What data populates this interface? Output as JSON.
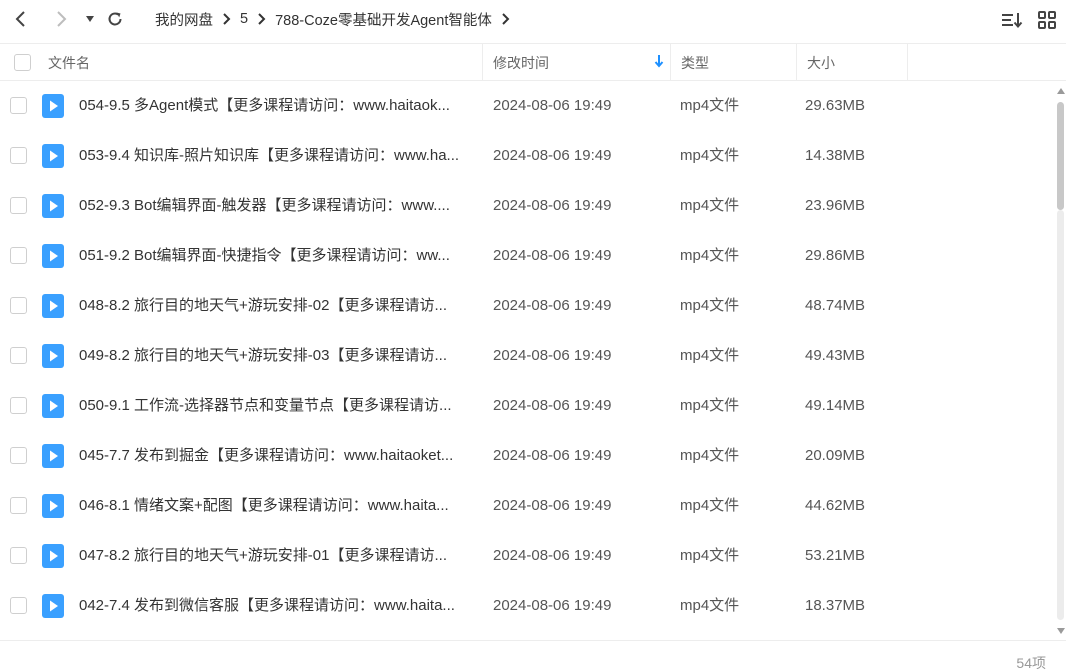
{
  "toolbar": {
    "back_icon": "chevron-left-icon",
    "forward_icon": "chevron-right-icon",
    "history_icon": "caret-down-icon",
    "refresh_icon": "refresh-icon",
    "sort_icon": "sort-list-icon",
    "view_icon": "grid-view-icon"
  },
  "breadcrumb": [
    "我的网盘",
    "5",
    "788-Coze零基础开发Agent智能体"
  ],
  "columns": {
    "name": "文件名",
    "modified": "修改时间",
    "type": "类型",
    "size": "大小"
  },
  "files": [
    {
      "name": "054-9.5 多Agent模式【更多课程请访问：www.haitaok...",
      "modified": "2024-08-06 19:49",
      "type": "mp4文件",
      "size": "29.63MB"
    },
    {
      "name": "053-9.4 知识库-照片知识库【更多课程请访问：www.ha...",
      "modified": "2024-08-06 19:49",
      "type": "mp4文件",
      "size": "14.38MB"
    },
    {
      "name": "052-9.3 Bot编辑界面-触发器【更多课程请访问：www....",
      "modified": "2024-08-06 19:49",
      "type": "mp4文件",
      "size": "23.96MB"
    },
    {
      "name": "051-9.2 Bot编辑界面-快捷指令【更多课程请访问：ww...",
      "modified": "2024-08-06 19:49",
      "type": "mp4文件",
      "size": "29.86MB"
    },
    {
      "name": "048-8.2 旅行目的地天气+游玩安排-02【更多课程请访...",
      "modified": "2024-08-06 19:49",
      "type": "mp4文件",
      "size": "48.74MB"
    },
    {
      "name": "049-8.2 旅行目的地天气+游玩安排-03【更多课程请访...",
      "modified": "2024-08-06 19:49",
      "type": "mp4文件",
      "size": "49.43MB"
    },
    {
      "name": "050-9.1 工作流-选择器节点和变量节点【更多课程请访...",
      "modified": "2024-08-06 19:49",
      "type": "mp4文件",
      "size": "49.14MB"
    },
    {
      "name": "045-7.7 发布到掘金【更多课程请访问：www.haitaoket...",
      "modified": "2024-08-06 19:49",
      "type": "mp4文件",
      "size": "20.09MB"
    },
    {
      "name": "046-8.1 情绪文案+配图【更多课程请访问：www.haita...",
      "modified": "2024-08-06 19:49",
      "type": "mp4文件",
      "size": "44.62MB"
    },
    {
      "name": "047-8.2 旅行目的地天气+游玩安排-01【更多课程请访...",
      "modified": "2024-08-06 19:49",
      "type": "mp4文件",
      "size": "53.21MB"
    },
    {
      "name": "042-7.4 发布到微信客服【更多课程请访问：www.haita...",
      "modified": "2024-08-06 19:49",
      "type": "mp4文件",
      "size": "18.37MB"
    }
  ],
  "footer": {
    "count": "54项"
  },
  "colors": {
    "accent": "#1e90ff",
    "file_icon": "#3aa0ff",
    "text": "#333333",
    "muted": "#666666"
  }
}
